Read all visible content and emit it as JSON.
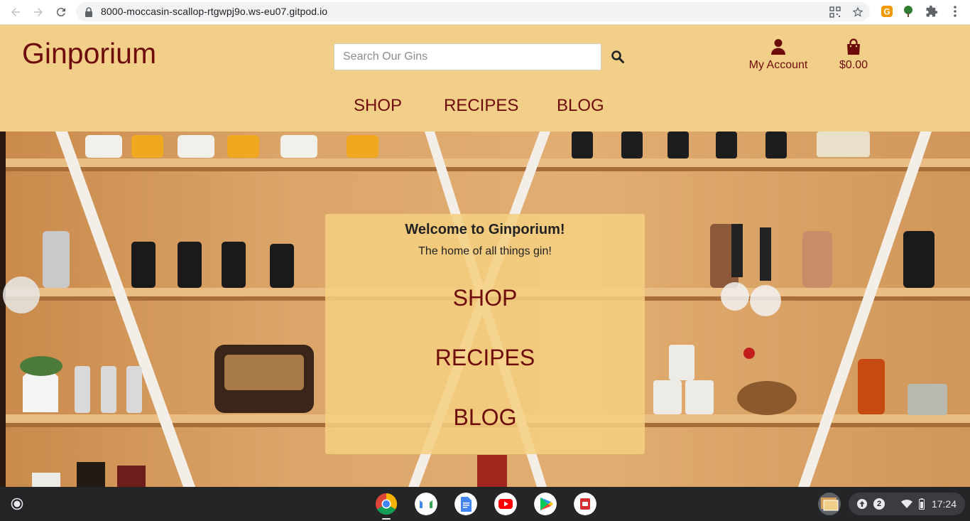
{
  "browser": {
    "url": "8000-moccasin-scallop-rtgwpj9o.ws-eu07.gitpod.io"
  },
  "site": {
    "brand": "Ginporium",
    "search_placeholder": "Search Our Gins",
    "account_label": "My Account",
    "bag_total": "$0.00",
    "nav": [
      "SHOP",
      "RECIPES",
      "BLOG"
    ]
  },
  "hero": {
    "title": "Welcome to Ginporium!",
    "subtitle": "The home of all things gin!",
    "links": [
      "SHOP",
      "RECIPES",
      "BLOG"
    ]
  },
  "taskbar": {
    "apps": [
      "chrome-icon",
      "gmail-icon",
      "docs-icon",
      "youtube-icon",
      "play-store-icon",
      "app-icon"
    ],
    "notification_count": "2",
    "time": "17:24"
  },
  "colors": {
    "header_bg": "#f2cf88",
    "brand": "#6e0c0c",
    "card_bg": "#f4cf80"
  }
}
